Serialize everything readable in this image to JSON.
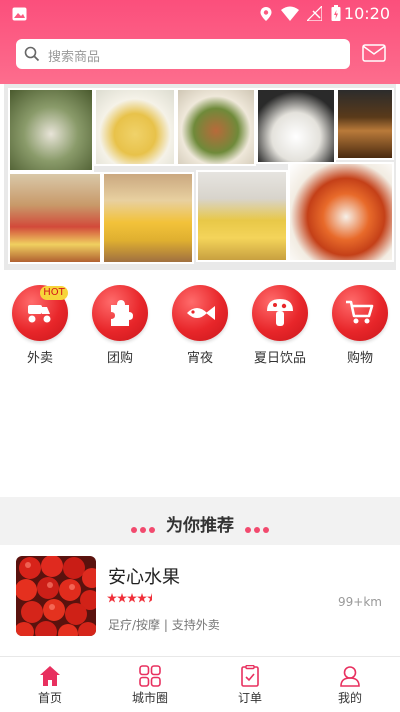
{
  "status_bar": {
    "time": "10:20"
  },
  "search": {
    "placeholder": "搜索商品"
  },
  "categories": [
    {
      "label": "外卖",
      "badge": "HOT",
      "icon": "scooter-icon"
    },
    {
      "label": "团购",
      "icon": "puzzle-icon"
    },
    {
      "label": "宵夜",
      "icon": "fish-icon"
    },
    {
      "label": "夏日饮品",
      "icon": "mushroom-icon"
    },
    {
      "label": "购物",
      "icon": "cart-icon"
    }
  ],
  "section": {
    "title": "为你推荐"
  },
  "recommendations": [
    {
      "name": "安心水果",
      "rating": 4.5,
      "distance": "99+km",
      "tags": "足疗/按摩 | 支持外卖"
    }
  ],
  "tabbar": [
    {
      "label": "首页",
      "active": true,
      "icon": "home-icon"
    },
    {
      "label": "城市圈",
      "icon": "grid-icon"
    },
    {
      "label": "订单",
      "icon": "order-icon"
    },
    {
      "label": "我的",
      "icon": "user-icon"
    }
  ],
  "colors": {
    "brand": "#fb4f7c",
    "category": "#e8262a",
    "hot_badge": "#f7d43a",
    "active_tab": "#e8305f"
  }
}
